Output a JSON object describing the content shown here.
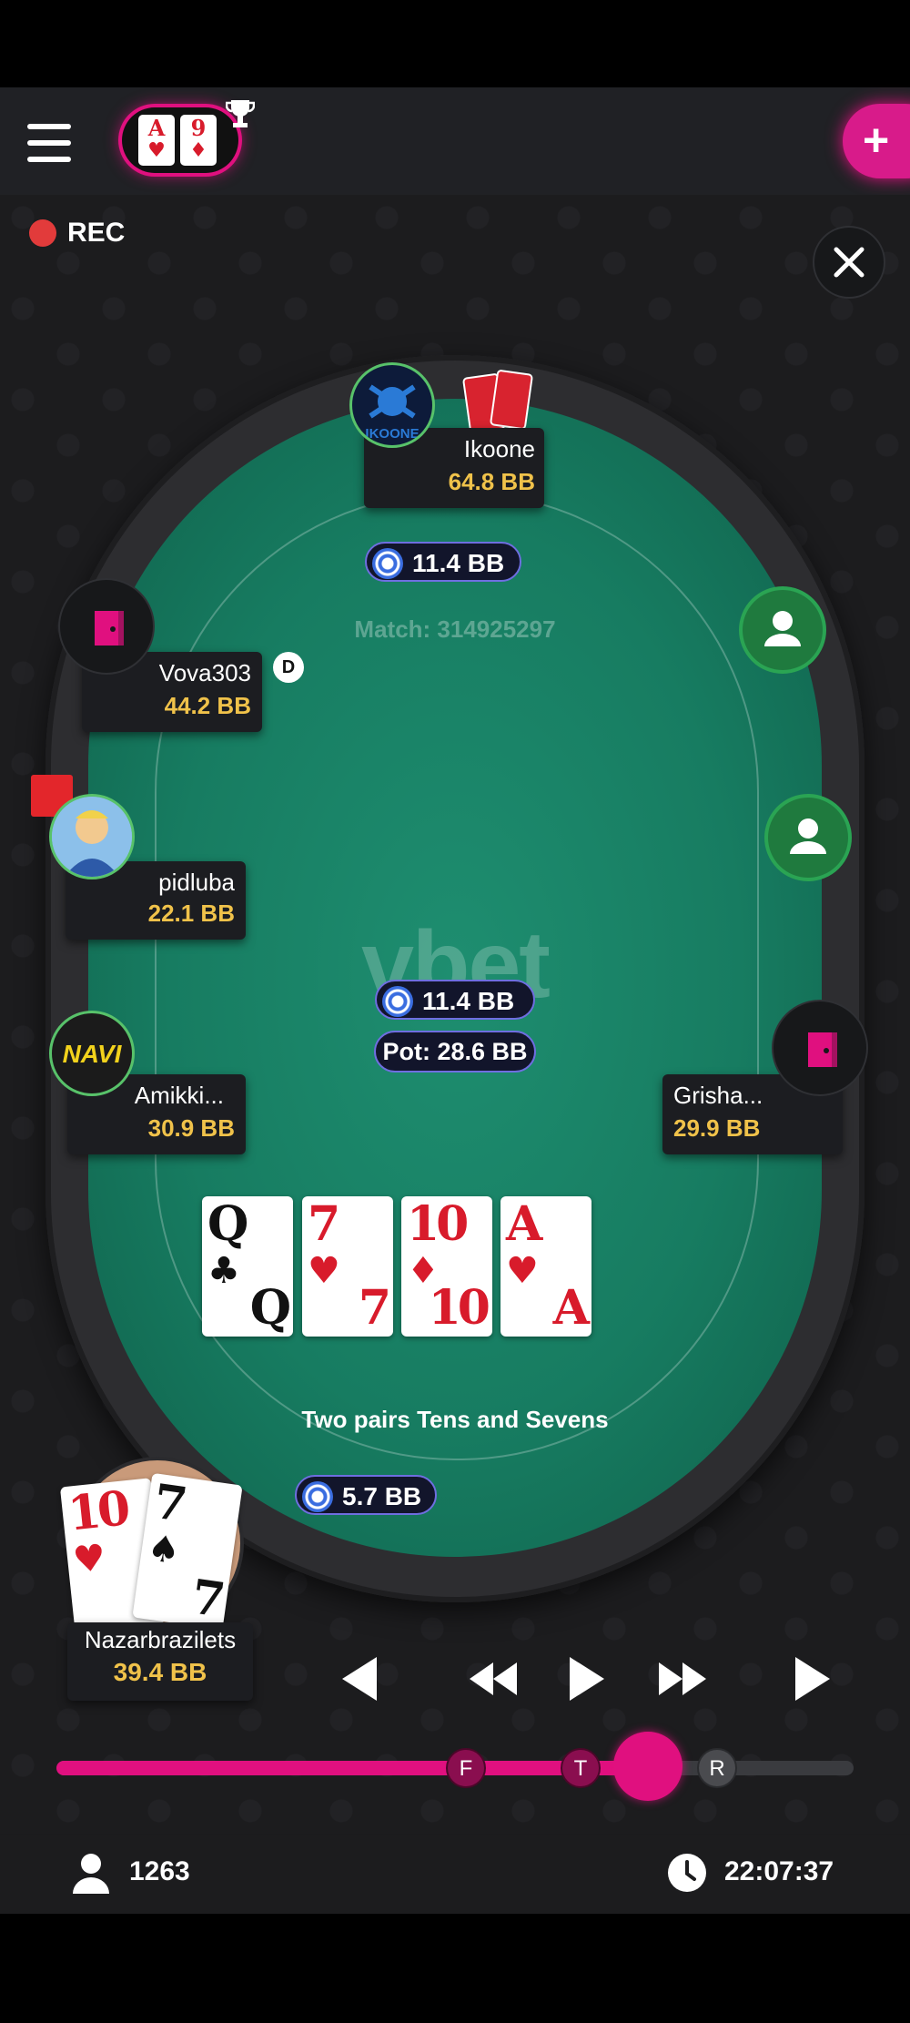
{
  "header": {
    "logo_cards": [
      {
        "rank": "A",
        "suit": "♥"
      },
      {
        "rank": "9",
        "suit": "♦"
      }
    ],
    "plus_label": "+",
    "rec_label": "REC"
  },
  "table": {
    "brand": "vbet",
    "match_label": "Match: 314925297",
    "pot_label": "Pot: 28.6 BB",
    "center_bet": "11.4 BB",
    "hand_description": "Two pairs Tens and Sevens",
    "dealer_label": "D"
  },
  "players": {
    "ikoone": {
      "name": "Ikoone",
      "stack": "64.8 BB",
      "bet": "11.4 BB",
      "avatar_text": "IKOONE"
    },
    "vova": {
      "name": "Vova303",
      "stack": "44.2 BB"
    },
    "pidluba": {
      "name": "pidluba",
      "stack": "22.1 BB"
    },
    "amikki": {
      "name": "Amikki...",
      "stack": "30.9 BB",
      "avatar_text": "NAVI"
    },
    "grisha": {
      "name": "Grisha...",
      "stack": "29.9 BB"
    },
    "hero": {
      "name": "Nazarbrazilets",
      "stack": "39.4 BB",
      "bet": "5.7 BB"
    }
  },
  "board": [
    {
      "rank": "Q",
      "suit": "♣",
      "color": "#111111"
    },
    {
      "rank": "7",
      "suit": "♥",
      "color": "#d81b2b"
    },
    {
      "rank": "10",
      "suit": "♦",
      "color": "#d81b2b"
    },
    {
      "rank": "A",
      "suit": "♥",
      "color": "#d81b2b"
    }
  ],
  "hero_cards": [
    {
      "rank": "10",
      "suit": "♥",
      "color": "#d81b2b"
    },
    {
      "rank": "7",
      "suit": "♠",
      "color": "#111111"
    }
  ],
  "replay": {
    "markers": [
      "F",
      "T",
      "R"
    ],
    "progress": 0.73
  },
  "footer": {
    "viewers": "1263",
    "time": "22:07:37"
  },
  "colors": {
    "accent": "#e0107f",
    "felt": "#177c61",
    "stack": "#f0c24a",
    "seat_green": "#1f7a3e"
  }
}
